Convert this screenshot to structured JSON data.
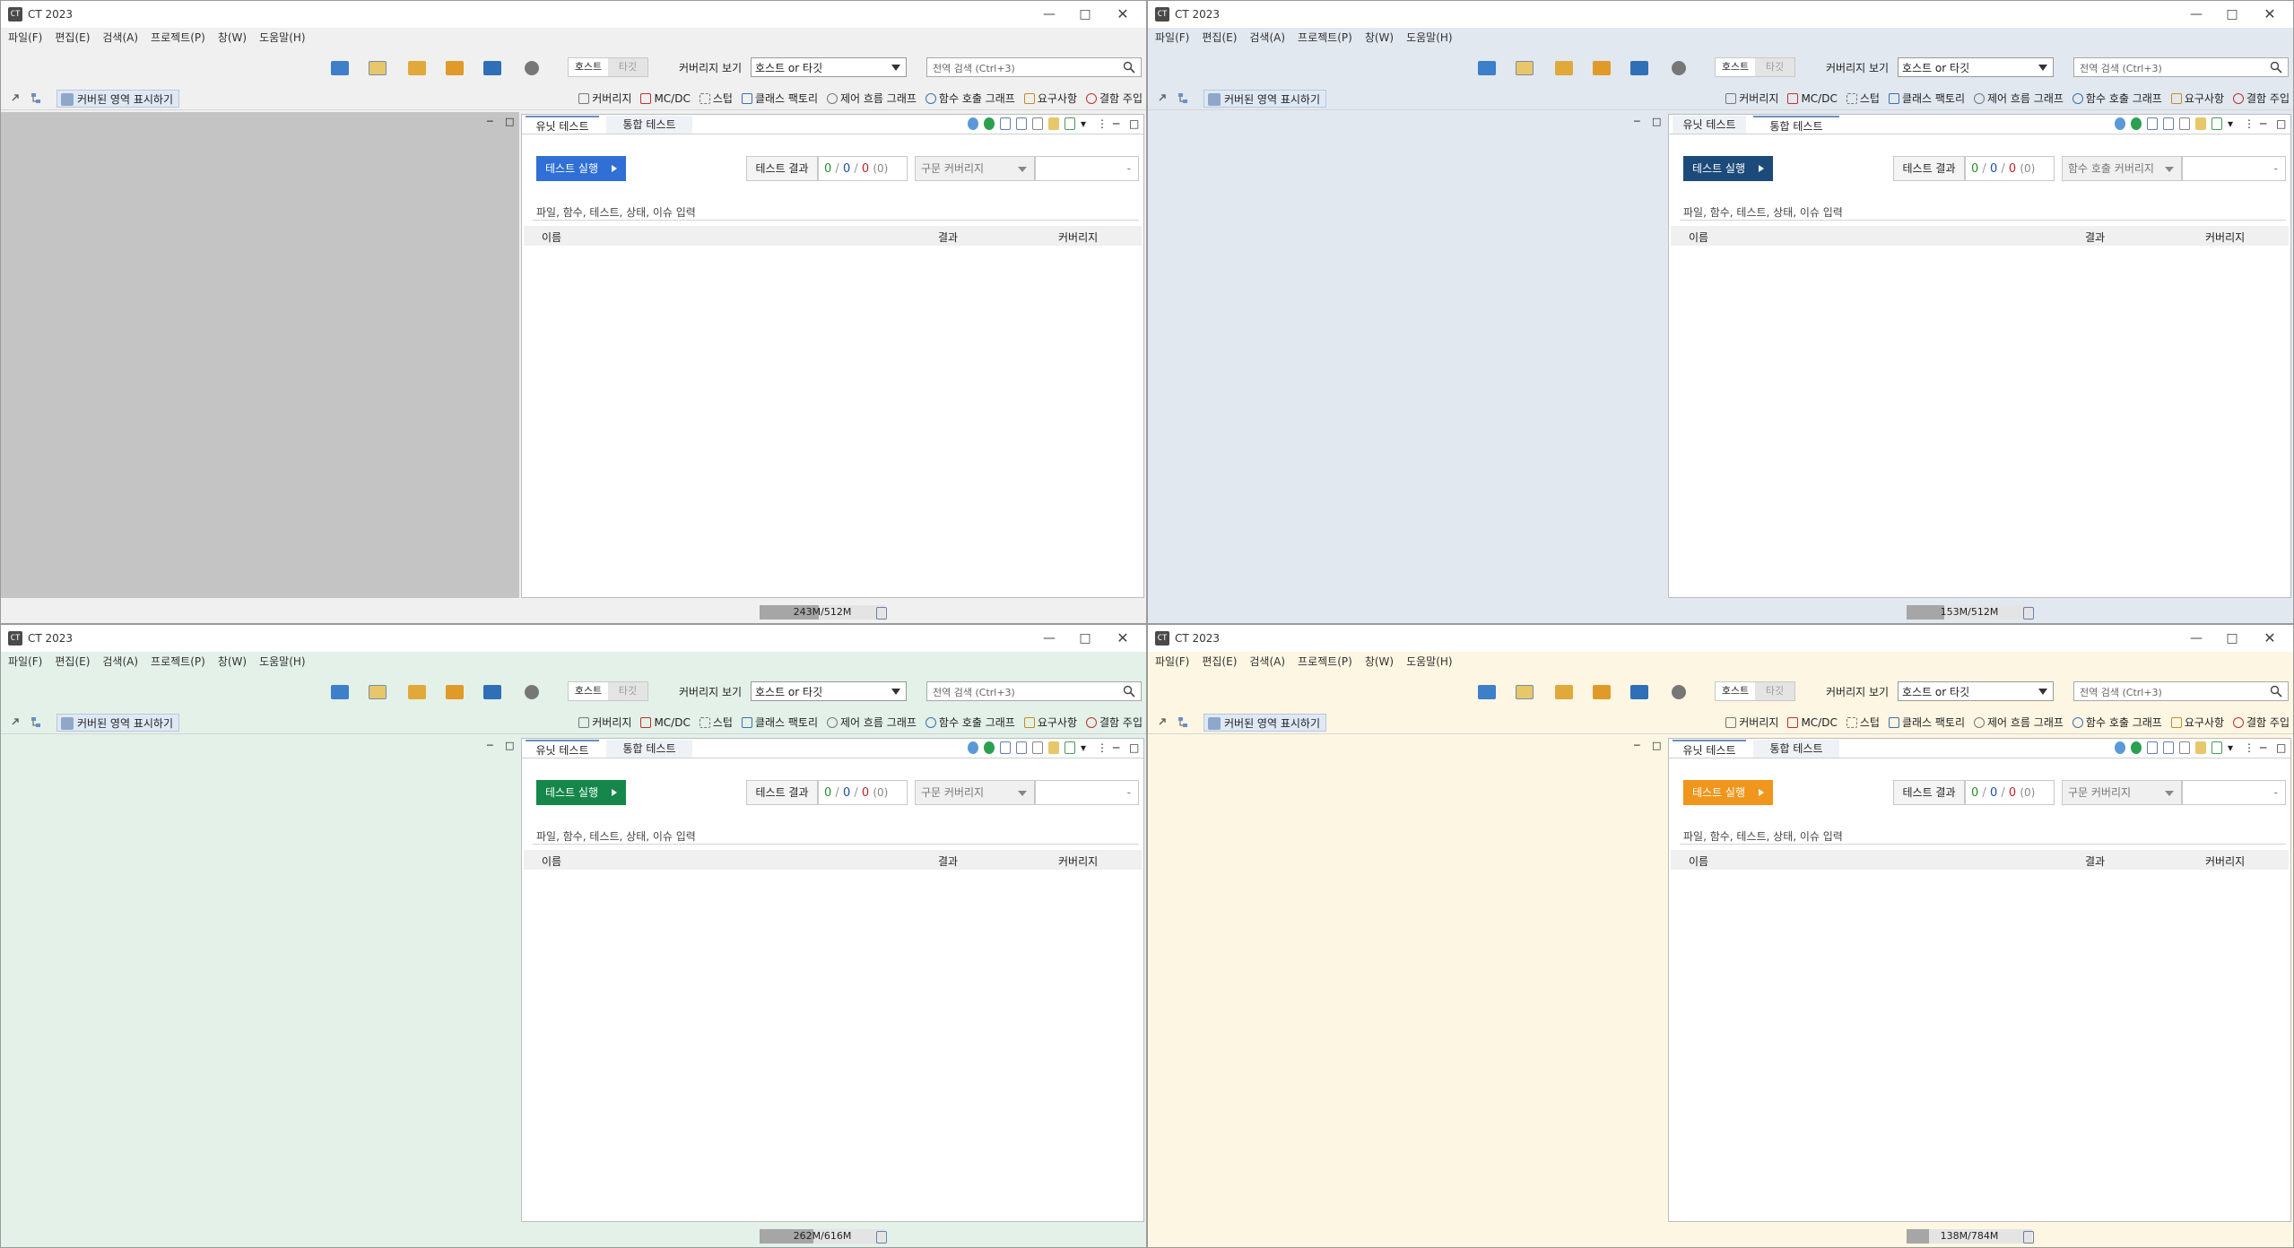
{
  "app": {
    "title": "CT 2023",
    "menus": [
      "파일(F)",
      "편집(E)",
      "검색(A)",
      "프로젝트(P)",
      "창(W)",
      "도움말(H)"
    ],
    "toolbar": {
      "host_label": "호스트",
      "target_label": "타깃",
      "coverage_view_label": "커버리지 보기",
      "coverage_view_value": "호스트 or 타깃",
      "search_placeholder": "전역 검색 (Ctrl+3)"
    },
    "perspective": {
      "show_covered_label": "커버된 영역 표시하기",
      "items": [
        "커버리지",
        "MC/DC",
        "스텁",
        "클래스 팩토리",
        "제어 흐름 그래프",
        "함수 호출 그래프",
        "요구사항",
        "결함 주입"
      ]
    },
    "tabs": {
      "unit": "유닛 테스트",
      "integration": "통합 테스트"
    },
    "run_label": "테스트 실행",
    "result_label": "테스트 결과",
    "counts": {
      "pass": "0",
      "fail": "0",
      "error": "0",
      "skipped": "(0)",
      "sep": "/"
    },
    "coverage_value": "-",
    "filter_placeholder": "파일, 함수, 테스트, 상태, 이슈 입력",
    "columns": {
      "name": "이름",
      "result": "결과",
      "coverage": "커버리지"
    }
  },
  "windows": [
    {
      "id": "gray",
      "theme": {
        "window_bg": "#f0f0f0",
        "left_panel_bg": "#c4c4c4",
        "accent": "#2f6fd6",
        "toolbar_bg": "#f0f0f0"
      },
      "active_tab": "unit",
      "coverage_kind": "구문 커버리지",
      "heap": {
        "text": "243M/512M",
        "fraction": 0.47
      }
    },
    {
      "id": "blue",
      "theme": {
        "window_bg": "#e2e8f0",
        "left_panel_bg": "#e2e8f0",
        "accent": "#1c4a7a",
        "toolbar_bg": "#e2e8f0"
      },
      "active_tab": "integration",
      "coverage_kind": "함수 호출 커버리지",
      "heap": {
        "text": "153M/512M",
        "fraction": 0.3
      }
    },
    {
      "id": "green",
      "theme": {
        "window_bg": "#e3f1e8",
        "left_panel_bg": "#e3f1e8",
        "accent": "#16874a",
        "toolbar_bg": "#e3f1e8"
      },
      "active_tab": "unit",
      "coverage_kind": "구문 커버리지",
      "heap": {
        "text": "262M/616M",
        "fraction": 0.43
      }
    },
    {
      "id": "yellow",
      "theme": {
        "window_bg": "#fdf6e2",
        "left_panel_bg": "#fdf6e2",
        "accent": "#f0961c",
        "toolbar_bg": "#fdf6e2"
      },
      "active_tab": "unit",
      "coverage_kind": "구문 커버리지",
      "heap": {
        "text": "138M/784M",
        "fraction": 0.18
      }
    }
  ]
}
